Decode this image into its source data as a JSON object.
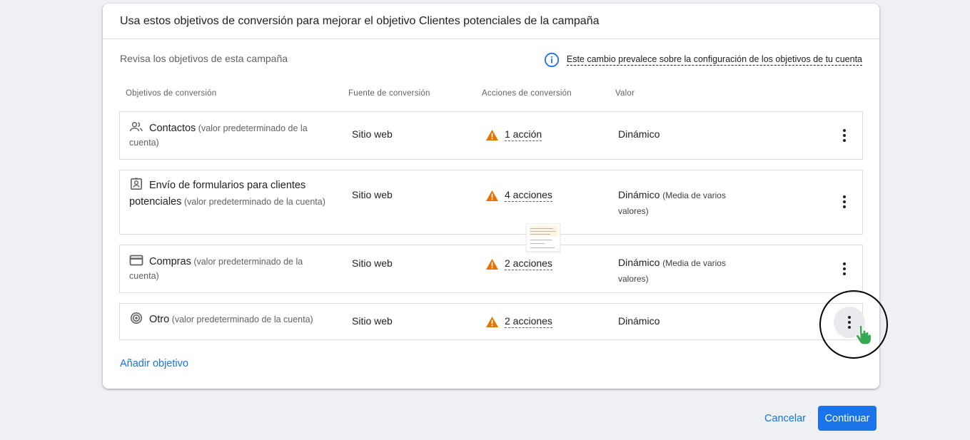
{
  "dialog": {
    "title": "Usa estos objetivos de conversión para mejorar el objetivo Clientes potenciales de la campaña",
    "review_label": "Revisa los objetivos de esta campaña",
    "notice_text": "Este cambio prevalece sobre la configuración de los objetivos de tu cuenta",
    "notice_icon": "info-icon"
  },
  "table": {
    "headers": {
      "goal": "Objetivos de conversión",
      "source": "Fuente de conversión",
      "actions": "Acciones de conversión",
      "value": "Valor"
    },
    "rows": [
      {
        "icon": "contacts-icon",
        "name": "Contactos",
        "note": "(valor predeterminado de la cuenta)",
        "source": "Sitio web",
        "actions": "1 acción",
        "value": "Dinámico",
        "value_note": ""
      },
      {
        "icon": "lead-form-icon",
        "name": "Envío de formularios para clientes potenciales",
        "note": "(valor predeterminado de la cuenta)",
        "source": "Sitio web",
        "actions": "4 acciones",
        "value": "Dinámico",
        "value_note": "(Media de varios valores)"
      },
      {
        "icon": "credit-card-icon",
        "name": "Compras",
        "note": "(valor predeterminado de la cuenta)",
        "source": "Sitio web",
        "actions": "2 acciones",
        "value": "Dinámico",
        "value_note": "(Media de varios valores)"
      },
      {
        "icon": "target-icon",
        "name": "Otro",
        "note": "(valor predeterminado de la cuenta)",
        "source": "Sitio web",
        "actions": "2 acciones",
        "value": "Dinámico",
        "value_note": ""
      }
    ]
  },
  "add_goal_label": "Añadir objetivo",
  "footer": {
    "cancel_label": "Cancelar",
    "continue_label": "Continuar"
  },
  "colors": {
    "accent": "#1a73e8",
    "warning": "#e37400",
    "background": "#eef0f3"
  }
}
